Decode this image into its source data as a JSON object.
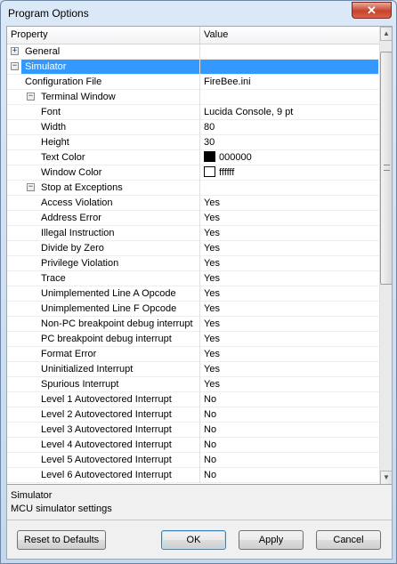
{
  "window": {
    "title": "Program Options",
    "close_glyph": "✕"
  },
  "grid": {
    "headers": {
      "property": "Property",
      "value": "Value"
    },
    "rows": [
      {
        "name": "General",
        "value": "",
        "level": 0,
        "toggle": "+",
        "selected": false
      },
      {
        "name": "Simulator",
        "value": "",
        "level": 0,
        "toggle": "−",
        "selected": true
      },
      {
        "name": "Configuration File",
        "value": "FireBee.ini",
        "level": 1
      },
      {
        "name": "Terminal Window",
        "value": "",
        "level": 1,
        "toggle": "−"
      },
      {
        "name": "Font",
        "value": "Lucida Console, 9 pt",
        "level": 2
      },
      {
        "name": "Width",
        "value": "80",
        "level": 2
      },
      {
        "name": "Height",
        "value": "30",
        "level": 2
      },
      {
        "name": "Text Color",
        "value": "000000",
        "level": 2,
        "swatch": "#000000"
      },
      {
        "name": "Window Color",
        "value": "ffffff",
        "level": 2,
        "swatch": "#ffffff"
      },
      {
        "name": "Stop at Exceptions",
        "value": "",
        "level": 1,
        "toggle": "−"
      },
      {
        "name": "Access Violation",
        "value": "Yes",
        "level": 2
      },
      {
        "name": "Address Error",
        "value": "Yes",
        "level": 2
      },
      {
        "name": "Illegal Instruction",
        "value": "Yes",
        "level": 2
      },
      {
        "name": "Divide by Zero",
        "value": "Yes",
        "level": 2
      },
      {
        "name": "Privilege Violation",
        "value": "Yes",
        "level": 2
      },
      {
        "name": "Trace",
        "value": "Yes",
        "level": 2
      },
      {
        "name": "Unimplemented Line A Opcode",
        "value": "Yes",
        "level": 2
      },
      {
        "name": "Unimplemented Line F Opcode",
        "value": "Yes",
        "level": 2
      },
      {
        "name": "Non-PC breakpoint debug interrupt",
        "value": "Yes",
        "level": 2
      },
      {
        "name": "PC breakpoint debug interrupt",
        "value": "Yes",
        "level": 2
      },
      {
        "name": "Format Error",
        "value": "Yes",
        "level": 2
      },
      {
        "name": "Uninitialized Interrupt",
        "value": "Yes",
        "level": 2
      },
      {
        "name": "Spurious Interrupt",
        "value": "Yes",
        "level": 2
      },
      {
        "name": "Level 1 Autovectored Interrupt",
        "value": "No",
        "level": 2
      },
      {
        "name": "Level 2 Autovectored Interrupt",
        "value": "No",
        "level": 2
      },
      {
        "name": "Level 3 Autovectored Interrupt",
        "value": "No",
        "level": 2
      },
      {
        "name": "Level 4 Autovectored Interrupt",
        "value": "No",
        "level": 2
      },
      {
        "name": "Level 5 Autovectored Interrupt",
        "value": "No",
        "level": 2
      },
      {
        "name": "Level 6 Autovectored Interrupt",
        "value": "No",
        "level": 2
      }
    ]
  },
  "description": {
    "title": "Simulator",
    "text": "MCU simulator settings"
  },
  "buttons": {
    "reset": "Reset to Defaults",
    "ok": "OK",
    "apply": "Apply",
    "cancel": "Cancel"
  },
  "colors": {
    "selection": "#3399ff",
    "close": "#c7432c"
  }
}
